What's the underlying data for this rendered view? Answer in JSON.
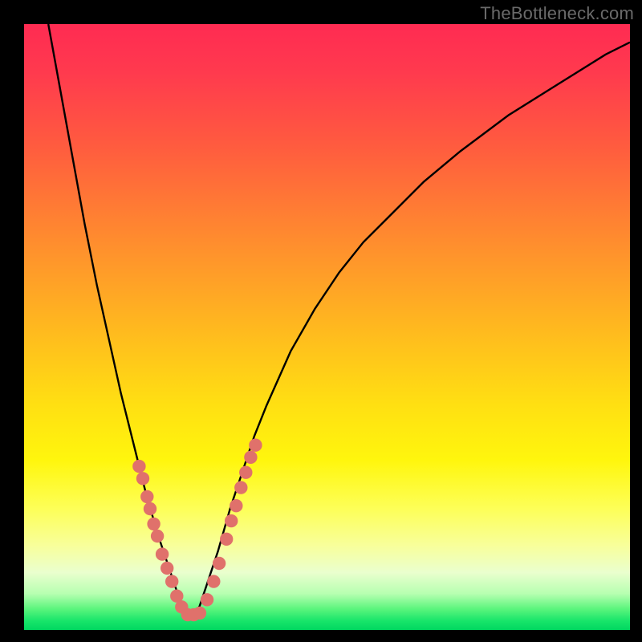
{
  "watermark": "TheBottleneck.com",
  "colors": {
    "gradient_stops": [
      {
        "offset": 0.0,
        "color": "#ff2b52"
      },
      {
        "offset": 0.08,
        "color": "#ff3a4e"
      },
      {
        "offset": 0.2,
        "color": "#ff5b3f"
      },
      {
        "offset": 0.35,
        "color": "#ff8a2f"
      },
      {
        "offset": 0.5,
        "color": "#ffb81f"
      },
      {
        "offset": 0.63,
        "color": "#ffe012"
      },
      {
        "offset": 0.72,
        "color": "#fff60d"
      },
      {
        "offset": 0.8,
        "color": "#fdff58"
      },
      {
        "offset": 0.86,
        "color": "#f8ff9a"
      },
      {
        "offset": 0.905,
        "color": "#eaffce"
      },
      {
        "offset": 0.94,
        "color": "#b7ffb1"
      },
      {
        "offset": 0.965,
        "color": "#5cf57d"
      },
      {
        "offset": 0.985,
        "color": "#18e56a"
      },
      {
        "offset": 1.0,
        "color": "#00d760"
      }
    ],
    "curve": "#000000",
    "marker_fill": "#e0716b",
    "marker_stroke": "#c95e58",
    "frame": "#000000"
  },
  "chart_data": {
    "type": "line",
    "title": "",
    "xlabel": "",
    "ylabel": "",
    "xlim": [
      0,
      100
    ],
    "ylim": [
      0,
      100
    ],
    "curve_x_at_min": 27,
    "curve_points_x": [
      4,
      6,
      8,
      10,
      12,
      14,
      16,
      18,
      20,
      22,
      24,
      25,
      26,
      27,
      28,
      29,
      30,
      32,
      34,
      36,
      38,
      40,
      44,
      48,
      52,
      56,
      60,
      66,
      72,
      80,
      88,
      96,
      100
    ],
    "curve_points_y": [
      100,
      89,
      78,
      67,
      57,
      48,
      39,
      31,
      23,
      16,
      10,
      7,
      4,
      2,
      2,
      4,
      7,
      13,
      20,
      26,
      32,
      37,
      46,
      53,
      59,
      64,
      68,
      74,
      79,
      85,
      90,
      95,
      97
    ],
    "markers": [
      {
        "x": 19.0,
        "y": 27
      },
      {
        "x": 19.6,
        "y": 25
      },
      {
        "x": 20.3,
        "y": 22
      },
      {
        "x": 20.8,
        "y": 20
      },
      {
        "x": 21.4,
        "y": 17.5
      },
      {
        "x": 22.0,
        "y": 15.5
      },
      {
        "x": 22.8,
        "y": 12.5
      },
      {
        "x": 23.6,
        "y": 10.2
      },
      {
        "x": 24.4,
        "y": 8.0
      },
      {
        "x": 25.2,
        "y": 5.6
      },
      {
        "x": 26.0,
        "y": 3.8
      },
      {
        "x": 27.0,
        "y": 2.5
      },
      {
        "x": 28.0,
        "y": 2.5
      },
      {
        "x": 29.0,
        "y": 2.8
      },
      {
        "x": 30.2,
        "y": 5.0
      },
      {
        "x": 31.3,
        "y": 8.0
      },
      {
        "x": 32.2,
        "y": 11.0
      },
      {
        "x": 33.4,
        "y": 15.0
      },
      {
        "x": 34.2,
        "y": 18.0
      },
      {
        "x": 35.0,
        "y": 20.5
      },
      {
        "x": 35.8,
        "y": 23.5
      },
      {
        "x": 36.6,
        "y": 26.0
      },
      {
        "x": 37.4,
        "y": 28.5
      },
      {
        "x": 38.2,
        "y": 30.5
      }
    ]
  }
}
